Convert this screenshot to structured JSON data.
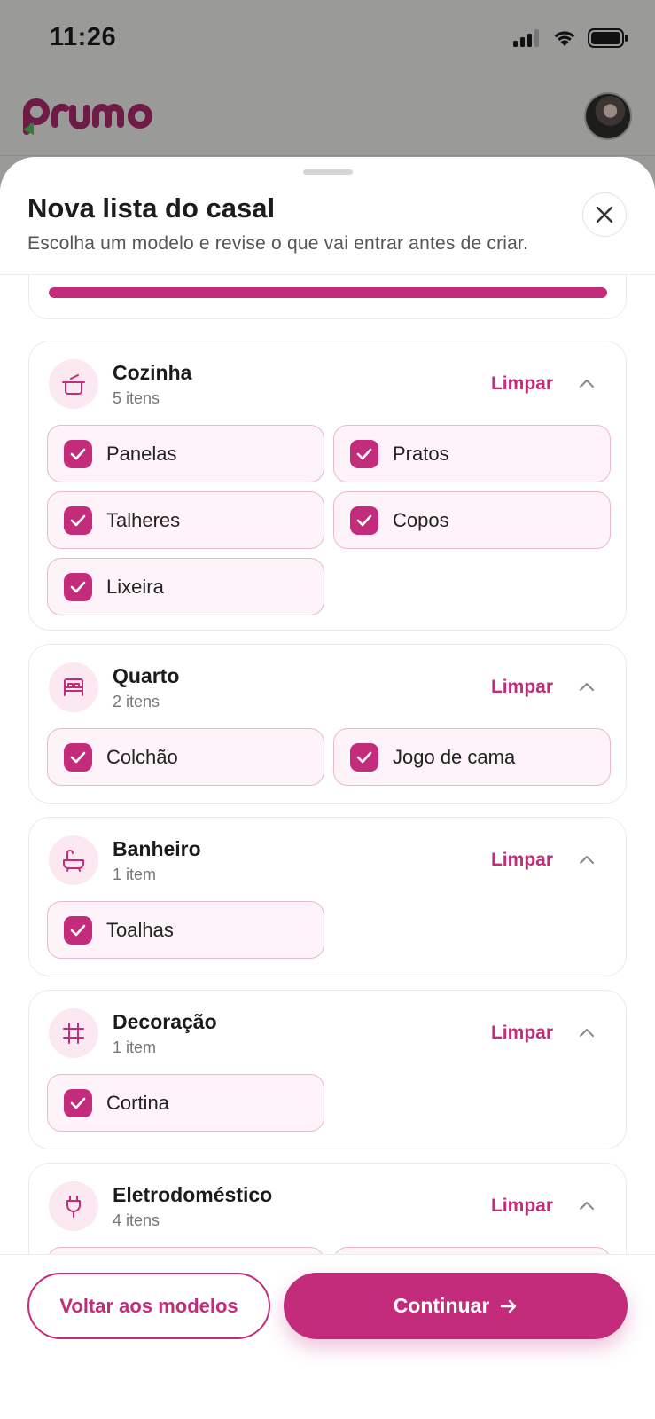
{
  "status_bar": {
    "time": "11:26"
  },
  "app": {
    "logo_text": "prumo"
  },
  "sheet": {
    "title": "Nova lista do casal",
    "subtitle": "Escolha um modelo e revise o que vai entrar antes de criar.",
    "progress_fraction": 1.0
  },
  "categories": [
    {
      "name": "Cozinha",
      "count": "5 itens",
      "clear_label": "Limpar",
      "icon": "pot-icon",
      "items": [
        "Panelas",
        "Pratos",
        "Talheres",
        "Copos",
        "Lixeira"
      ]
    },
    {
      "name": "Quarto",
      "count": "2 itens",
      "clear_label": "Limpar",
      "icon": "bed-icon",
      "items": [
        "Colchão",
        "Jogo de cama"
      ]
    },
    {
      "name": "Banheiro",
      "count": "1 item",
      "clear_label": "Limpar",
      "icon": "bathtub-icon",
      "items": [
        "Toalhas"
      ]
    },
    {
      "name": "Decoração",
      "count": "1 item",
      "clear_label": "Limpar",
      "icon": "frame-icon",
      "items": [
        "Cortina"
      ]
    },
    {
      "name": "Eletrodoméstico",
      "count": "4 itens",
      "clear_label": "Limpar",
      "icon": "plug-icon",
      "items": []
    }
  ],
  "footer": {
    "back_label": "Voltar aos modelos",
    "continue_label": "Continuar"
  },
  "colors": {
    "accent": "#c22c7a",
    "accent_soft": "#fce8f1"
  }
}
